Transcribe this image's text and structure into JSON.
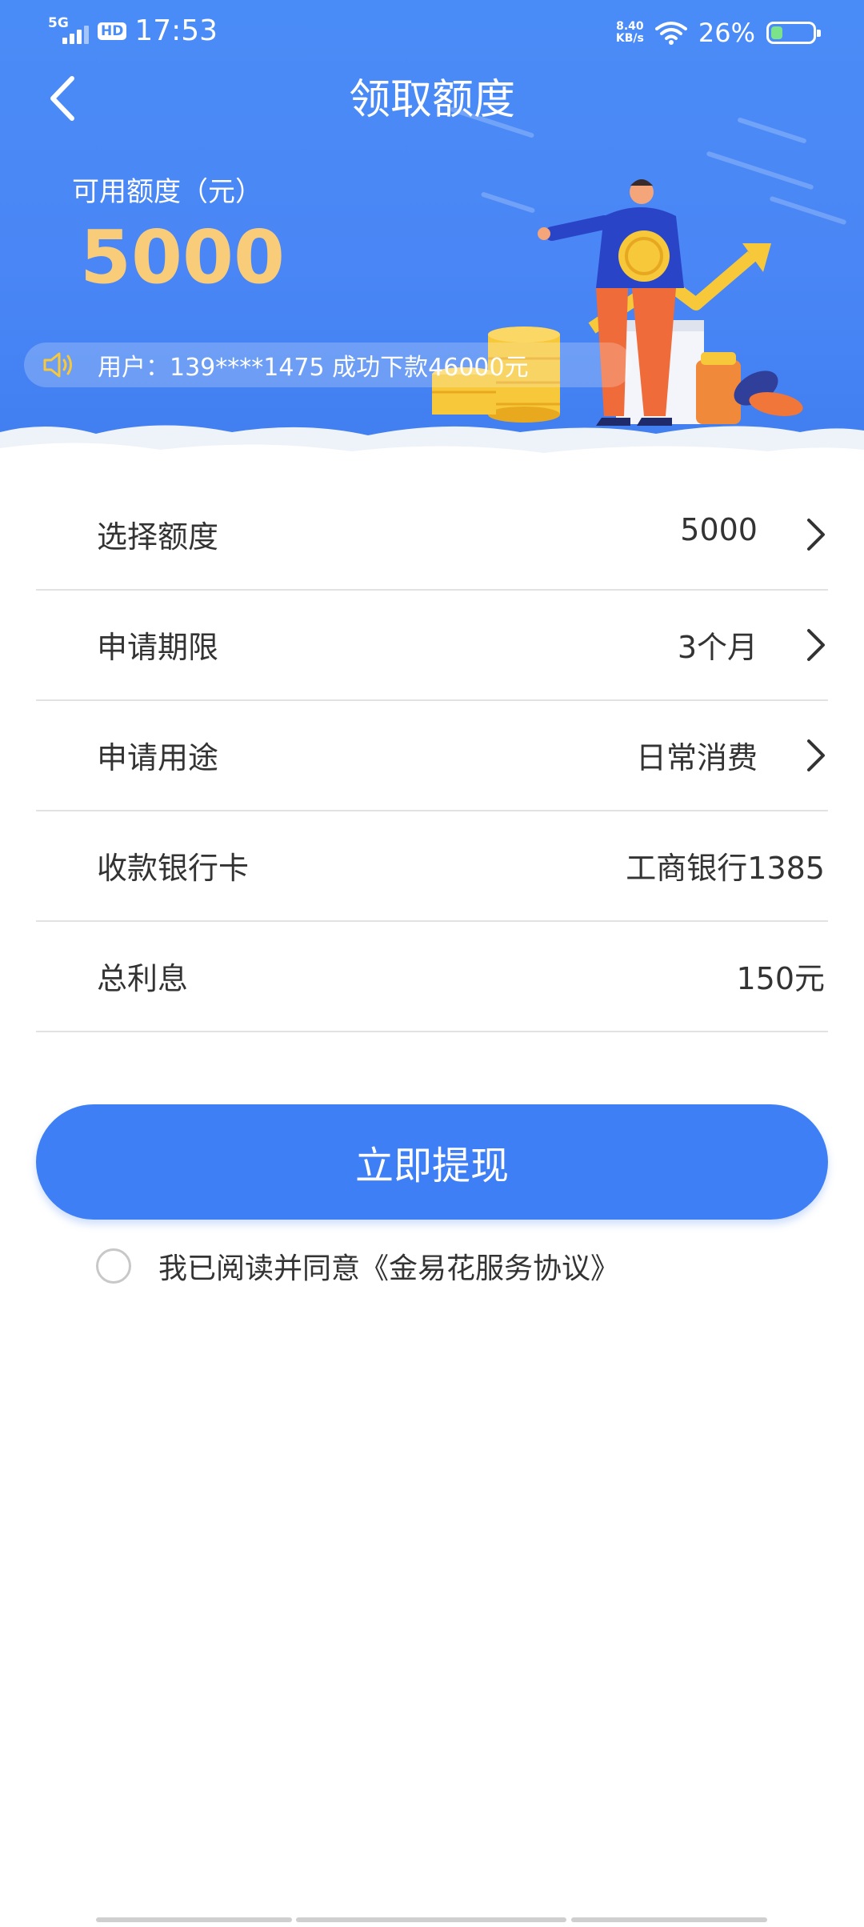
{
  "status_bar": {
    "network": "5G",
    "hd": "HD",
    "time": "17:53",
    "speed_value": "8.40",
    "speed_unit": "KB/s",
    "battery": "26%"
  },
  "header": {
    "title": "领取额度",
    "back_icon": "chevron-left-icon"
  },
  "hero": {
    "available_label": "可用额度（元）",
    "available_amount": "5000",
    "ticker_icon": "speaker-icon",
    "ticker_text": "用户：139****1475   成功下款46000元"
  },
  "form": {
    "rows": [
      {
        "label": "选择额度",
        "value": "5000",
        "has_arrow": true
      },
      {
        "label": "申请期限",
        "value": "3个月",
        "has_arrow": true
      },
      {
        "label": "申请用途",
        "value": "日常消费",
        "has_arrow": true
      },
      {
        "label": "收款银行卡",
        "value": "工商银行1385",
        "has_arrow": false
      },
      {
        "label": "总利息",
        "value": "150元",
        "has_arrow": false
      }
    ]
  },
  "actions": {
    "submit_label": "立即提现",
    "agreement_text": "我已阅读并同意《金易花服务协议》",
    "agreement_checked": false
  },
  "colors": {
    "primary": "#3f7ff5",
    "amount": "#f9cc79",
    "text": "#333333"
  }
}
